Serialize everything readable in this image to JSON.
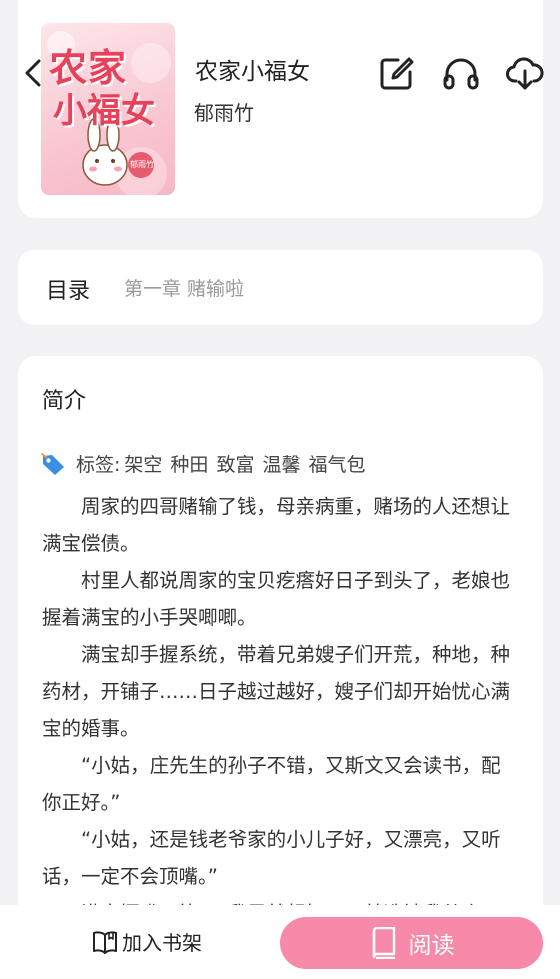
{
  "book": {
    "title": "农家小福女",
    "author": "郁雨竹",
    "cover_title_line1": "农家",
    "cover_title_line2": "小福女",
    "cover_author_stamp": "郁雨竹"
  },
  "header": {
    "icons": [
      "back-icon",
      "edit-icon",
      "headphones-icon",
      "download-icon"
    ]
  },
  "toc": {
    "label": "目录",
    "chapter": "第一章 赌输啦"
  },
  "intro": {
    "title": "简介",
    "tags_prefix": "标签:",
    "tags": [
      "架空",
      "种田",
      "致富",
      "温馨",
      "福气包"
    ],
    "paragraphs": [
      "周家的四哥赌输了钱，母亲病重，赌场的人还想让满宝偿债。",
      "村里人都说周家的宝贝疙瘩好日子到头了，老娘也握着满宝的小手哭唧唧。",
      "满宝却手握系统，带着兄弟嫂子们开荒，种地，种药材，开铺子……日子越过越好，嫂子们却开始忧心满宝的婚事。",
      "“小姑，庄先生的孙子不错，又斯文又会读书，配你正好。”",
      "“小姑，还是钱老爷家的小儿子好，又漂亮，又听话，一定不会顶嘴。”",
      "满宝撅嘴，等：“我早就想好了，就选被我从小"
    ]
  },
  "bottom": {
    "shelf_label": "加入书架",
    "read_label": "阅读"
  },
  "colors": {
    "accent": "#f78aa8",
    "tag_icon": "#3a8ee6",
    "background": "#f2f2f4"
  }
}
